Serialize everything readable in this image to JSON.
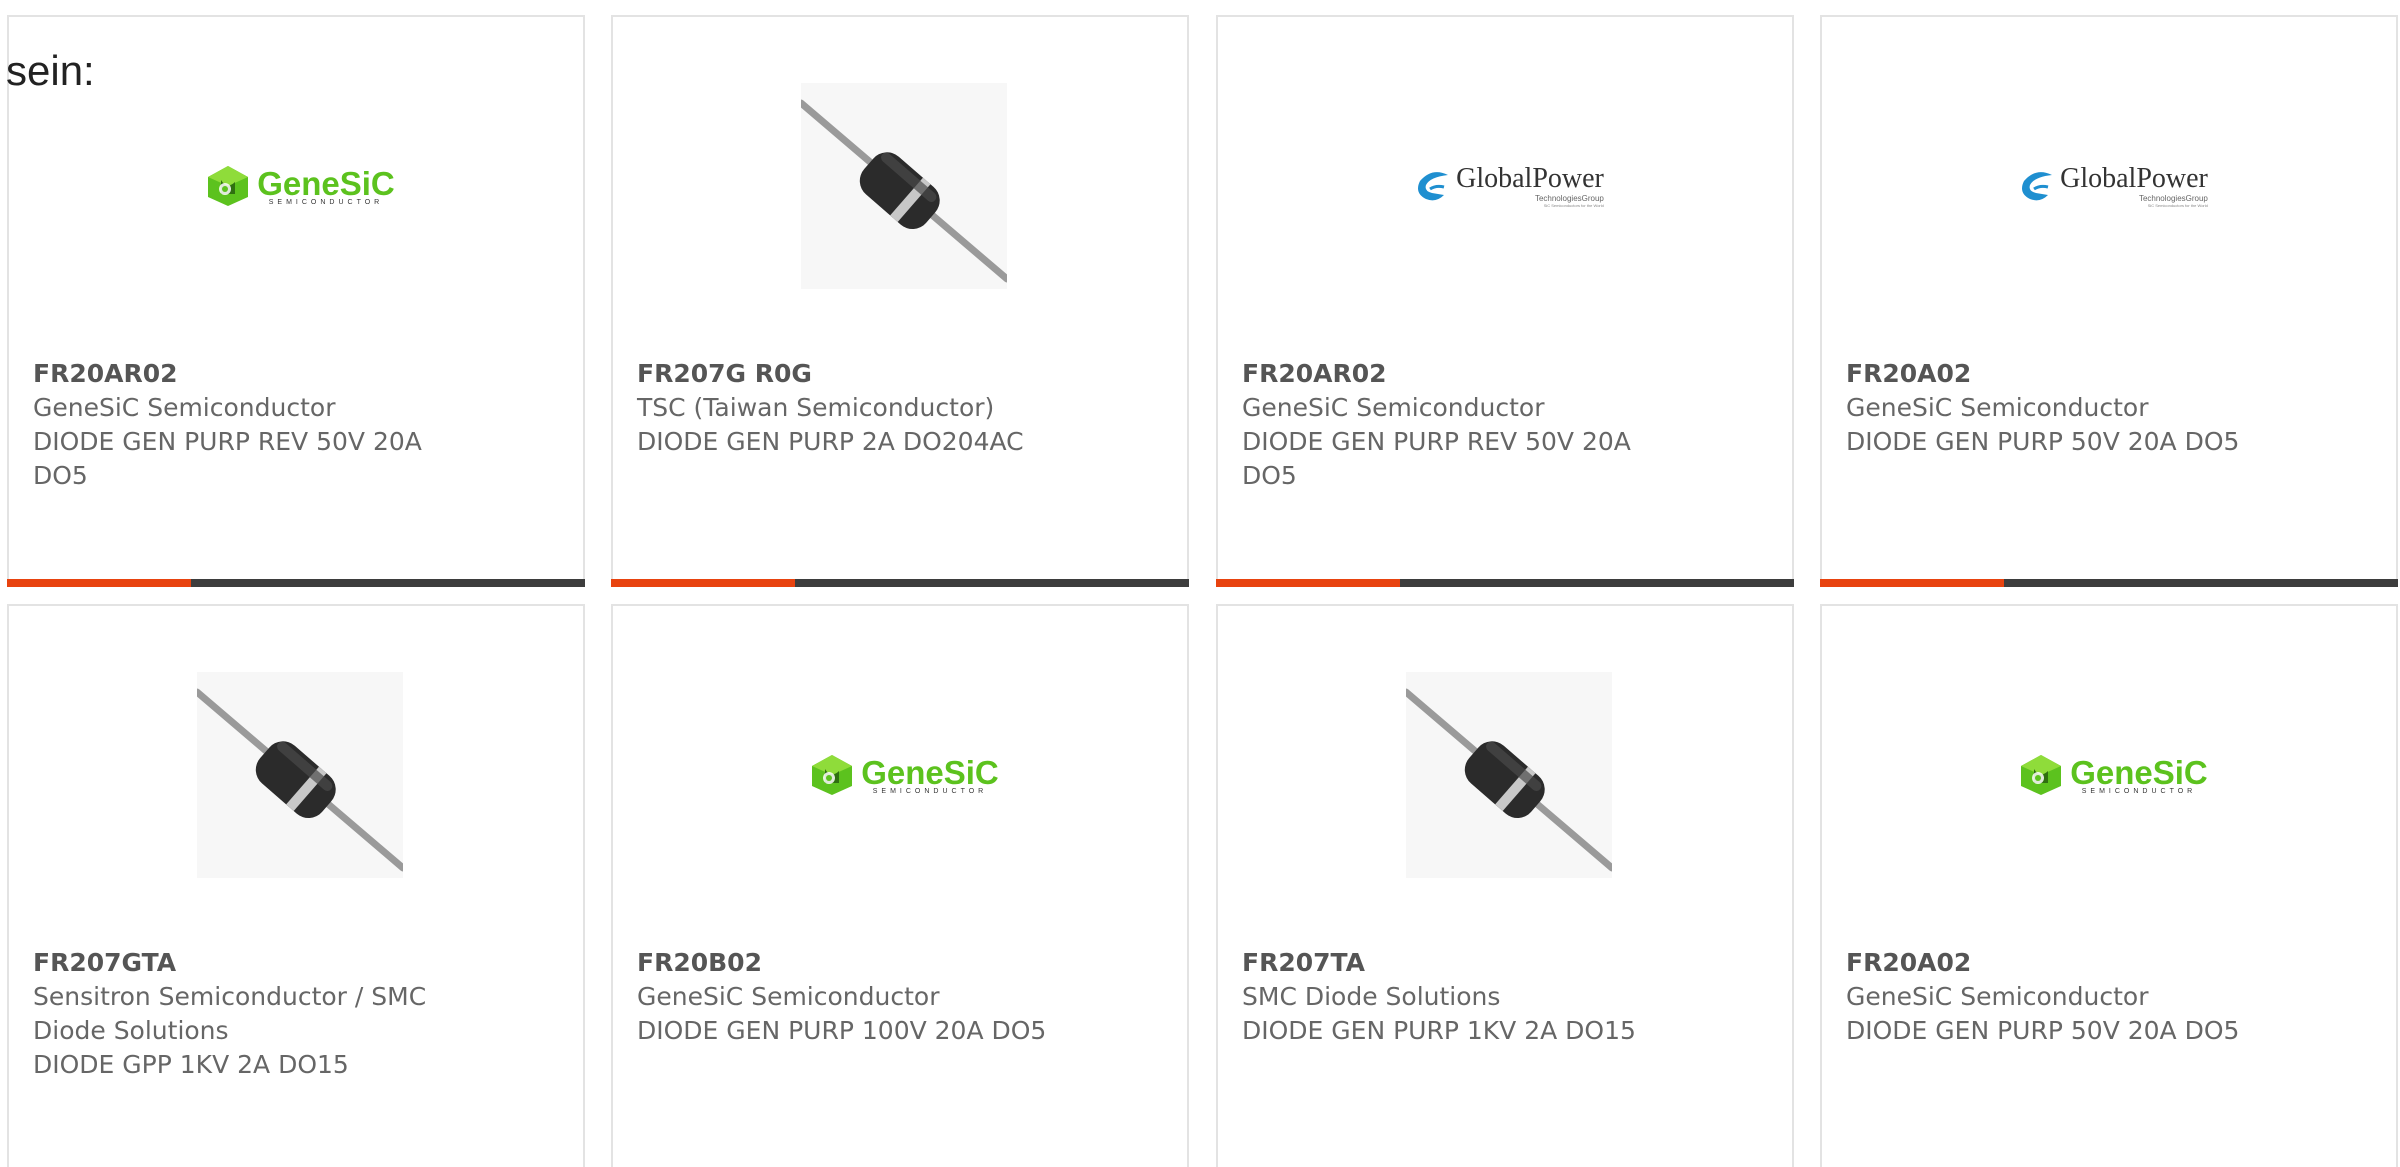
{
  "intro_text": "sein:",
  "cards": [
    {
      "part": "FR20AR02",
      "manufacturer": "GeneSiC Semiconductor",
      "description": "DIODE GEN PURP REV 50V 20A DO5",
      "image": "genesic-logo",
      "logo_text": "GeneSiC",
      "logo_sub": "SEMICONDUCTOR"
    },
    {
      "part": "FR207G R0G",
      "manufacturer": "TSC (Taiwan Semiconductor)",
      "description": "DIODE GEN PURP 2A DO204AC",
      "image": "axial-diode-photo"
    },
    {
      "part": "FR20AR02",
      "manufacturer": "GeneSiC Semiconductor",
      "description": "DIODE GEN PURP REV 50V 20A DO5",
      "image": "globalpower-logo",
      "logo_text": "GlobalPower",
      "logo_sub": "TechnologiesGroup",
      "logo_tag": "SiC Semiconductors for the World"
    },
    {
      "part": "FR20A02",
      "manufacturer": "GeneSiC Semiconductor",
      "description": "DIODE GEN PURP 50V 20A DO5",
      "image": "globalpower-logo",
      "logo_text": "GlobalPower",
      "logo_sub": "TechnologiesGroup",
      "logo_tag": "SiC Semiconductors for the World"
    },
    {
      "part": "FR207GTA",
      "manufacturer": "Sensitron Semiconductor / SMC Diode Solutions",
      "description": "DIODE GPP 1KV 2A DO15",
      "image": "axial-diode-photo"
    },
    {
      "part": "FR20B02",
      "manufacturer": "GeneSiC Semiconductor",
      "description": "DIODE GEN PURP 100V 20A DO5",
      "image": "genesic-logo",
      "logo_text": "GeneSiC",
      "logo_sub": "SEMICONDUCTOR"
    },
    {
      "part": "FR207TA",
      "manufacturer": "SMC Diode Solutions",
      "description": "DIODE GEN PURP 1KV 2A DO15",
      "image": "axial-diode-photo"
    },
    {
      "part": "FR20A02",
      "manufacturer": "GeneSiC Semiconductor",
      "description": "DIODE GEN PURP 50V 20A DO5",
      "image": "genesic-logo",
      "logo_text": "GeneSiC",
      "logo_sub": "SEMICONDUCTOR"
    }
  ],
  "colors": {
    "accent": "#e8430f",
    "bar_dark": "#3d3d3d",
    "genesic_green": "#5cc21e",
    "globalpower_blue": "#1f8fd0",
    "card_border": "#e3e3e3",
    "text": "#666666"
  }
}
